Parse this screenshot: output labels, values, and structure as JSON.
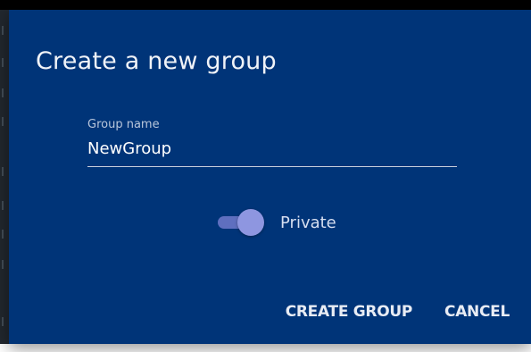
{
  "dialog": {
    "title": "Create a new group",
    "group_name": {
      "label": "Group name",
      "value": "NewGroup"
    },
    "private_toggle": {
      "label": "Private",
      "checked": true
    },
    "actions": {
      "create_label": "CREATE GROUP",
      "cancel_label": "CANCEL"
    }
  },
  "colors": {
    "dialog_background": "#003478",
    "toggle_thumb": "#8e96e0",
    "toggle_track": "#5f6fbf"
  }
}
